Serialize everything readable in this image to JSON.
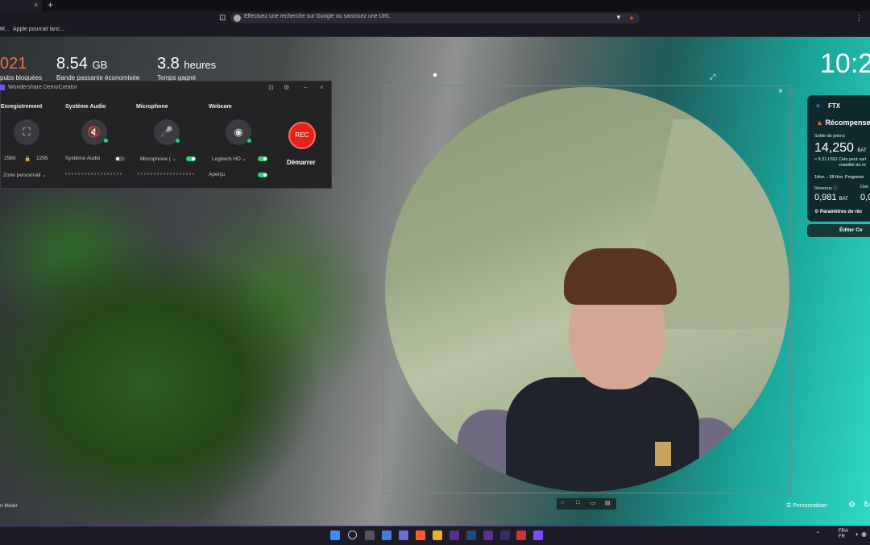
{
  "browser": {
    "tab_close": "×",
    "new_tab": "+",
    "bookmark_icon": "⊡",
    "omnibox_placeholder": "Effectuez une recherche sur Google ou saisissez une URL",
    "bookmarks": [
      "M...",
      "Apple pourrait lanc..."
    ],
    "more": "⋮"
  },
  "stats": [
    {
      "value": "021",
      "unit": "",
      "label": "pubs bloquées"
    },
    {
      "value": "8.54",
      "unit": "GB",
      "label": "Bande passante économisée"
    },
    {
      "value": "3.8",
      "unit": "heures",
      "label": "Temps gagné"
    }
  ],
  "clock": "10:2",
  "democreator": {
    "title": "Wondershare DemoCreator",
    "sections": {
      "recording": {
        "label": "Enregistrement",
        "width": "2560",
        "lock": "🔒",
        "height": "1295",
        "zone": "Zone personnali ⌄"
      },
      "system_audio": {
        "label": "Système Audio",
        "device": "Système Audio"
      },
      "microphone": {
        "label": "Microphone",
        "device": "Microphone ( ⌄"
      },
      "webcam": {
        "label": "Webcam",
        "device": "Logitech HD ⌄",
        "preview": "Aperçu"
      }
    },
    "rec_button": "REC",
    "start_label": "Démarrer",
    "colors": {
      "accent": "#e2231a",
      "active": "#2bd47a"
    }
  },
  "crypto": {
    "brand": "FTX",
    "title": "Récompense",
    "balance_label": "Solde de jetons",
    "balance_value": "14,250",
    "balance_unit": "BAT",
    "balance_usd": "≈ 9,31 USD",
    "balance_note": "Cela peut vari volatilité du m",
    "date_range": "1févr. - 28 févr. Progressi",
    "revenue_label": "Revenus ⓘ",
    "revenue_value": "0,981",
    "revenue_unit": "BAT",
    "donation_label": "Don",
    "donation_value": "0,0",
    "params": "⚙ Paramètres de réc",
    "edit_button": "Éditer Ce"
  },
  "bottom": {
    "personalize": "☰   Personnaliser",
    "credit": "n Meier"
  },
  "tray": {
    "lang": [
      "FRA",
      "FR"
    ]
  }
}
